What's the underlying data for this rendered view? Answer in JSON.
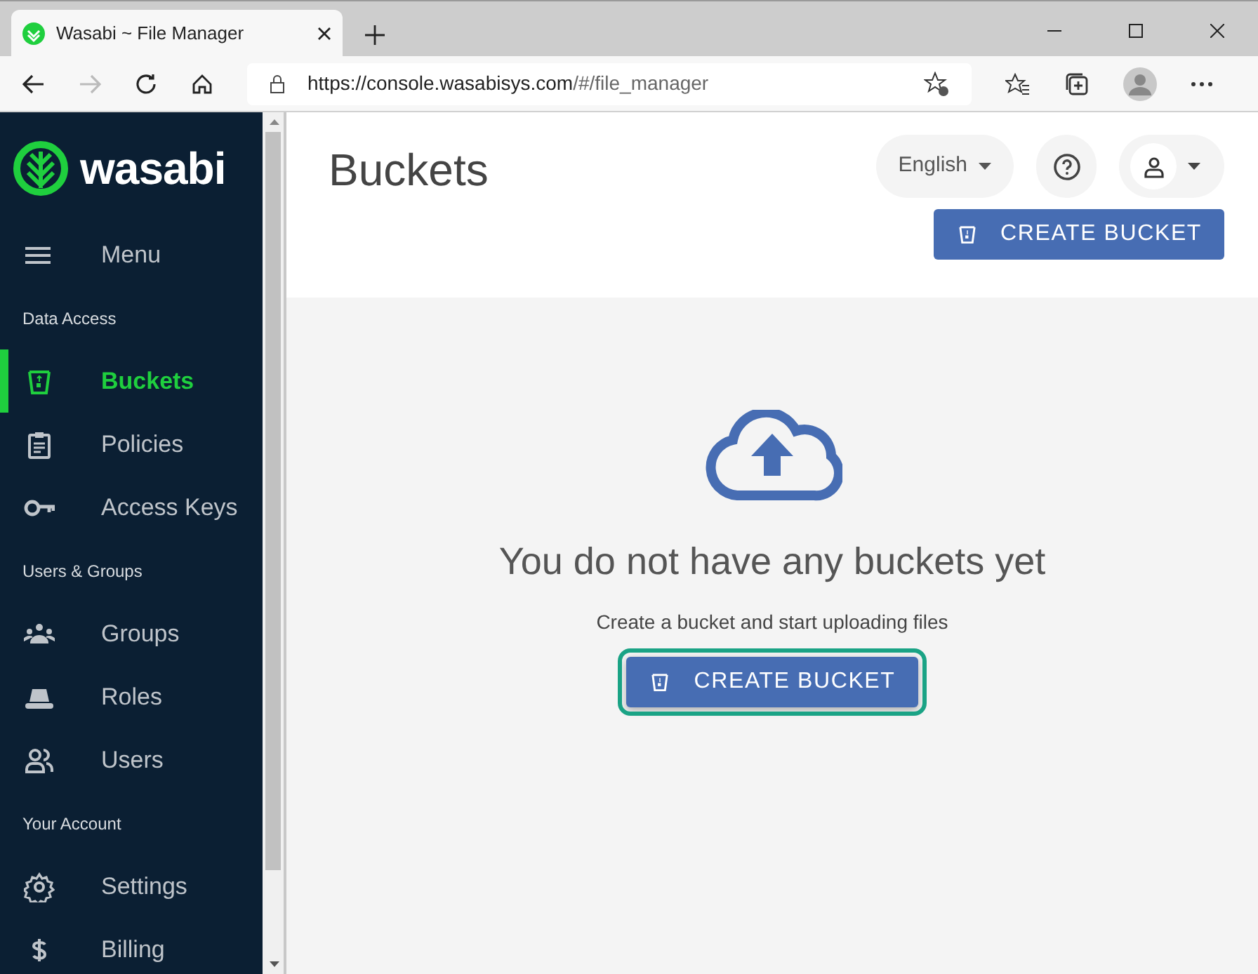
{
  "browser": {
    "tab_title": "Wasabi ~ File Manager",
    "url_host": "https://console.wasabisys.com",
    "url_path": "/#/file_manager"
  },
  "sidebar": {
    "logo_text": "wasabi",
    "menu_label": "Menu",
    "items": [
      {
        "kind": "heading",
        "label": "Data Access"
      },
      {
        "kind": "item",
        "label": "Buckets",
        "selected": true
      },
      {
        "kind": "item",
        "label": "Policies",
        "selected": false
      },
      {
        "kind": "item",
        "label": "Access Keys",
        "selected": false
      },
      {
        "kind": "heading",
        "label": "Users & Groups"
      },
      {
        "kind": "item",
        "label": "Groups",
        "selected": false
      },
      {
        "kind": "item",
        "label": "Roles",
        "selected": false
      },
      {
        "kind": "item",
        "label": "Users",
        "selected": false
      },
      {
        "kind": "heading",
        "label": "Your Account"
      },
      {
        "kind": "item",
        "label": "Settings",
        "selected": false
      },
      {
        "kind": "item",
        "label": "Billing",
        "selected": false
      }
    ]
  },
  "header": {
    "title": "Buckets",
    "language": "English",
    "create_button": "CREATE BUCKET"
  },
  "empty_state": {
    "heading": "You do not have any buckets yet",
    "text": "Create a bucket and start uploading files",
    "button": {
      "label": "CREATE BUCKET",
      "focused": true
    }
  }
}
